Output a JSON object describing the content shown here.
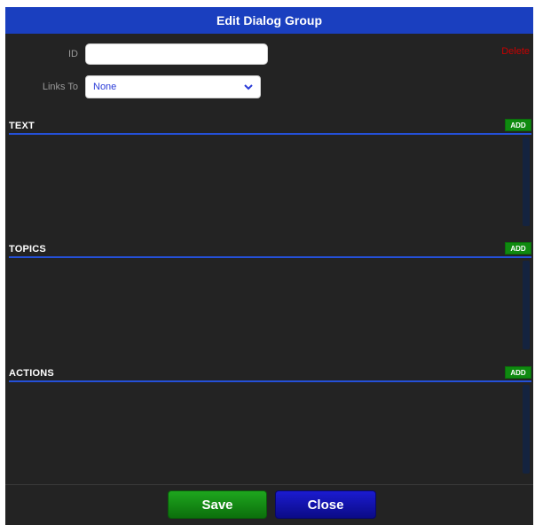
{
  "dialog": {
    "title": "Edit Dialog Group",
    "delete_label": "Delete"
  },
  "form": {
    "id_label": "ID",
    "id_value": "",
    "links_label": "Links To",
    "links_value": "None"
  },
  "sections": {
    "text": {
      "title": "TEXT",
      "add_label": "ADD"
    },
    "topics": {
      "title": "TOPICS",
      "add_label": "ADD"
    },
    "actions": {
      "title": "ACTIONS",
      "add_label": "ADD"
    }
  },
  "footer": {
    "save_label": "Save",
    "close_label": "Close"
  },
  "colors": {
    "title_bar": "#1a3fbf",
    "background": "#232323",
    "add_button": "#0f8a10",
    "save_button": "#1ea61e",
    "close_button": "#1b1bd0",
    "delete_link": "#c80000",
    "section_rule": "#2450d8"
  }
}
